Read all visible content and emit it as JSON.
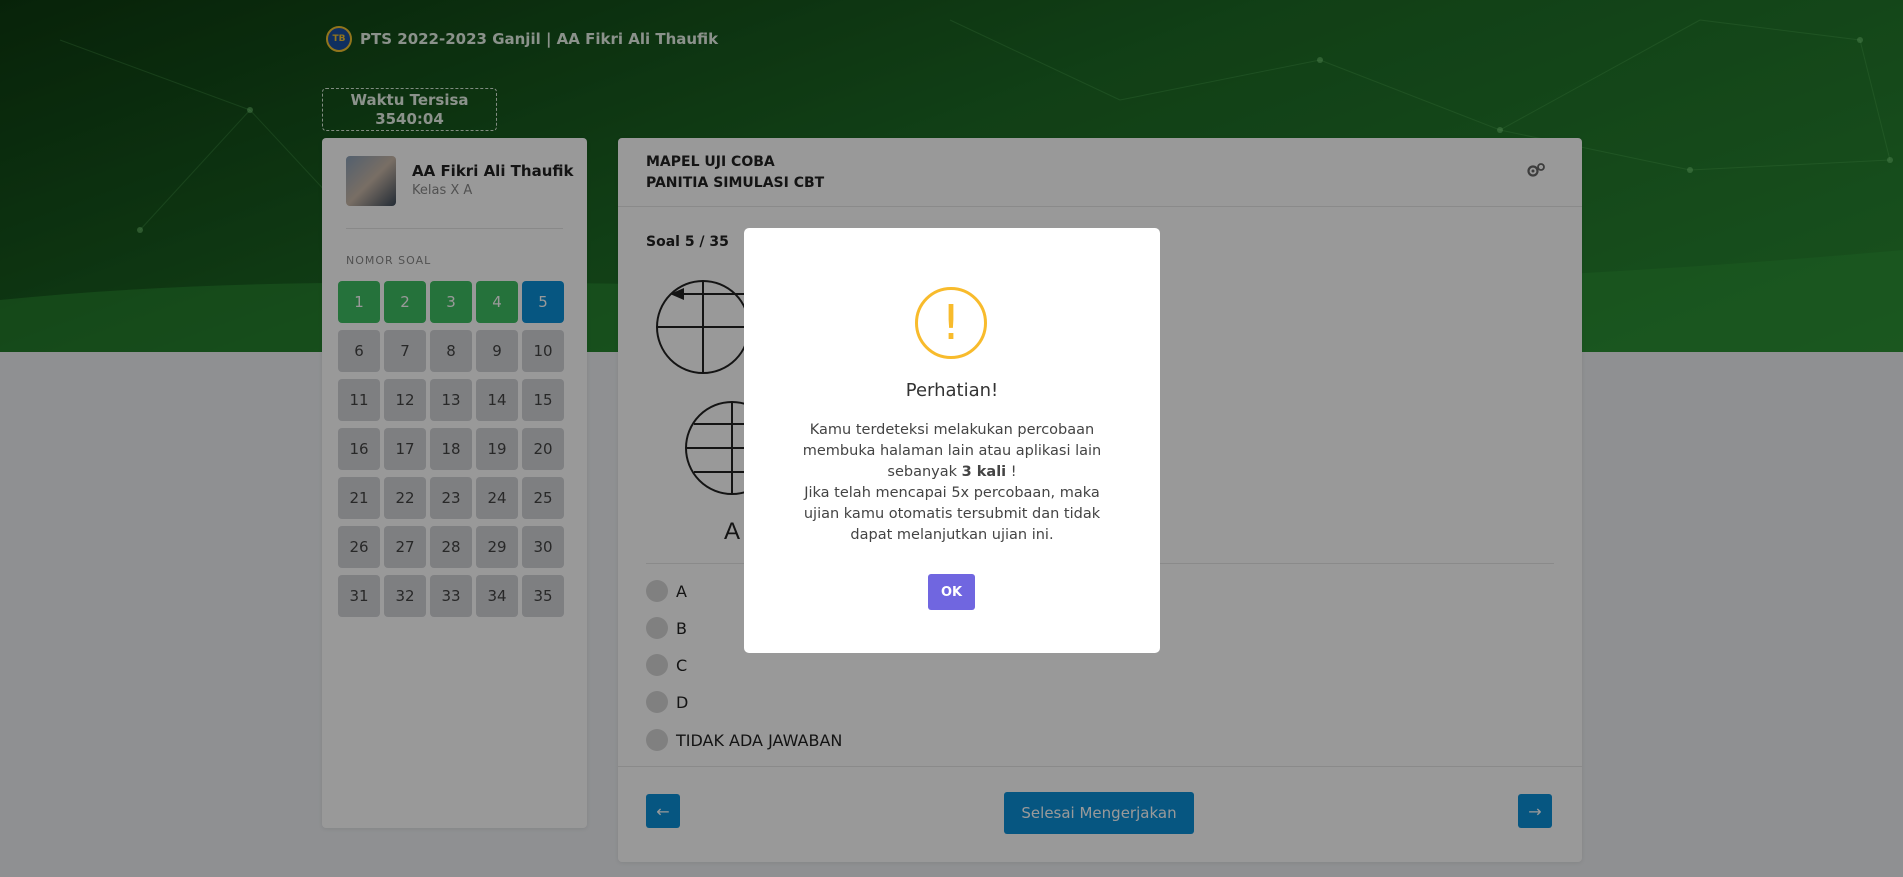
{
  "header": {
    "logo_icon": "school-logo-icon",
    "title": "PTS 2022-2023 Ganjil | AA Fikri Ali Thaufik"
  },
  "timer": {
    "label": "Waktu Tersisa",
    "value": "3540:04"
  },
  "sidebar": {
    "user_name": "AA Fikri Ali Thaufik",
    "user_class": "Kelas X A",
    "nomor_label": "NOMOR SOAL",
    "numbers": [
      "1",
      "2",
      "3",
      "4",
      "5",
      "6",
      "7",
      "8",
      "9",
      "10",
      "11",
      "12",
      "13",
      "14",
      "15",
      "16",
      "17",
      "18",
      "19",
      "20",
      "21",
      "22",
      "23",
      "24",
      "25",
      "26",
      "27",
      "28",
      "29",
      "30",
      "31",
      "32",
      "33",
      "34",
      "35"
    ],
    "answered_count": 4,
    "current": "5",
    "colors": {
      "answered": "#3fbe63",
      "current": "#0a8fd8",
      "unanswered": "#d2d4d8"
    }
  },
  "main": {
    "subject": "MAPEL UJI COBA",
    "committee": "PANITIA SIMULASI CBT",
    "settings_icon": "gears-icon",
    "question_counter": "Soal 5 / 35",
    "figure_label": "A",
    "options": [
      "A",
      "B",
      "C",
      "D",
      "TIDAK ADA JAWABAN"
    ],
    "prev_icon": "arrow-left-icon",
    "prev_symbol": "←",
    "next_icon": "arrow-right-icon",
    "next_symbol": "→",
    "finish_label": "Selesai Mengerjakan"
  },
  "modal": {
    "icon": "warning-icon",
    "icon_symbol": "!",
    "title": "Perhatian!",
    "body_part1": "Kamu terdeteksi melakukan percobaan membuka halaman lain atau aplikasi lain sebanyak ",
    "body_bold": "3 kali",
    "body_part2": " !",
    "body_line2": "Jika telah mencapai 5x percobaan, maka ujian kamu otomatis tersubmit dan tidak dapat melanjutkan ujian ini.",
    "ok_label": "OK",
    "colors": {
      "warning": "#f8bb2c",
      "ok_button": "#7066e0"
    }
  }
}
